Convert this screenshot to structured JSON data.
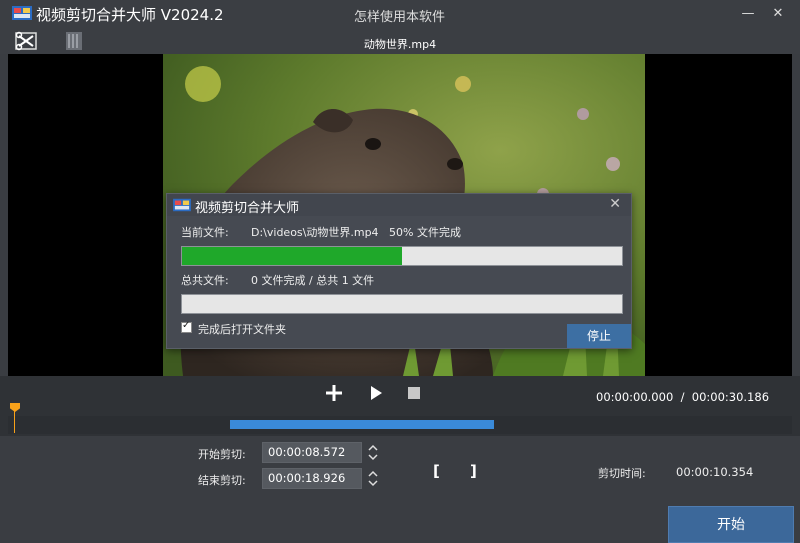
{
  "window": {
    "title": "视频剪切合并大师 V2024.2",
    "help_link": "怎样使用本软件",
    "minimize_glyph": "—",
    "close_glyph": "✕"
  },
  "toolbar": {
    "file_name": "动物世界.mp4",
    "icons": [
      "cut-icon",
      "film-icon"
    ]
  },
  "dialog": {
    "title": "视频剪切合并大师",
    "close_glyph": "✕",
    "current_file_label": "当前文件:",
    "current_file_status": "D:\\videos\\动物世界.mp4   50% 文件完成",
    "current_progress": 0.5,
    "total_file_label": "总共文件:",
    "total_file_status": "0 文件完成 / 总共 1 文件",
    "total_progress": 0,
    "checkbox_label": "完成后打开文件夹",
    "checkbox_checked": true,
    "stop_label": "停止"
  },
  "controls": {
    "time_display": "00:00:00.000  /  00:00:30.186",
    "icons": [
      "add-icon",
      "play-icon",
      "stop-icon"
    ]
  },
  "cut": {
    "start_label": "开始剪切:",
    "start_value": "00:00:08.572",
    "end_label": "结束剪切:",
    "end_value": "00:00:18.926",
    "bracket_left": "[",
    "bracket_right": "]",
    "duration_label": "剪切时间:",
    "duration_value": "00:00:10.354"
  },
  "actions": {
    "start_button": "开始"
  },
  "colors": {
    "accent": "#3c689a",
    "progress_green": "#1fa82a",
    "selection_blue": "#3a8ad9",
    "playhead_orange": "#f7a11a"
  }
}
